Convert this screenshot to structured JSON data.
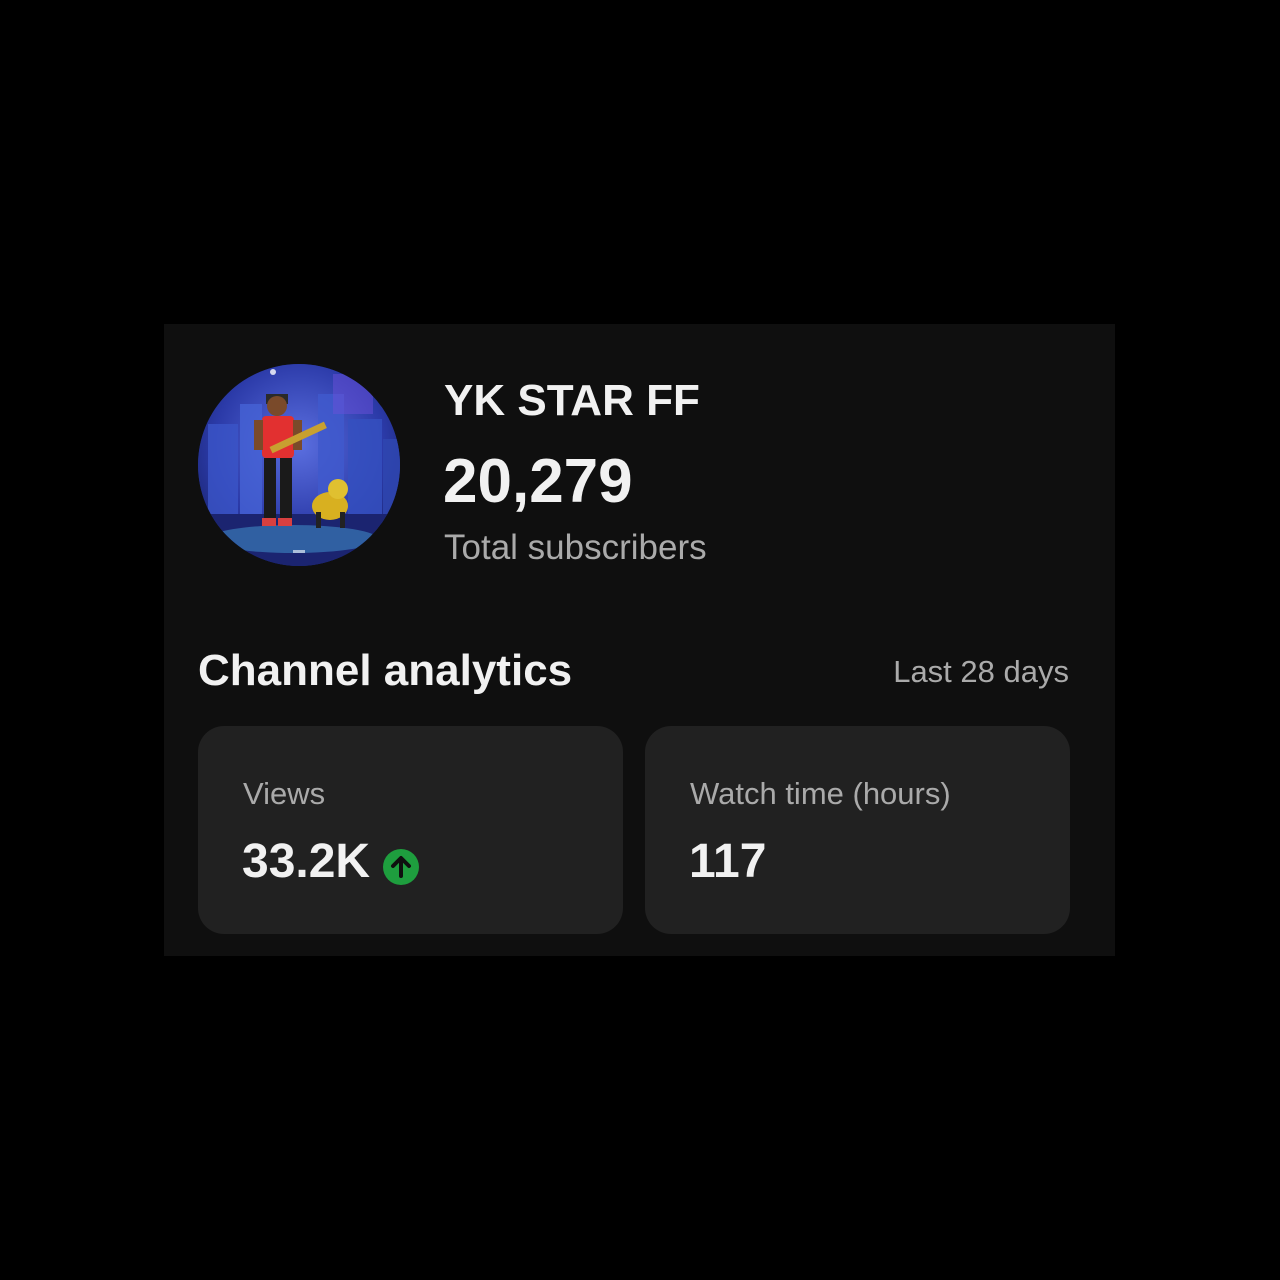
{
  "channel": {
    "name": "YK STAR FF",
    "subscriber_count": "20,279",
    "subscriber_label": "Total subscribers",
    "avatar_icon": "channel-avatar"
  },
  "analytics": {
    "title": "Channel analytics",
    "period": "Last 28 days",
    "metrics": [
      {
        "label": "Views",
        "value": "33.2K",
        "trend": "up",
        "trend_color": "#1e9e3e"
      },
      {
        "label": "Watch time (hours)",
        "value": "117"
      }
    ]
  },
  "colors": {
    "background": "#000000",
    "card": "#0f0f0f",
    "metric_card": "#212121",
    "primary_text": "#f1f1f1",
    "secondary_text": "#aaaaaa"
  }
}
